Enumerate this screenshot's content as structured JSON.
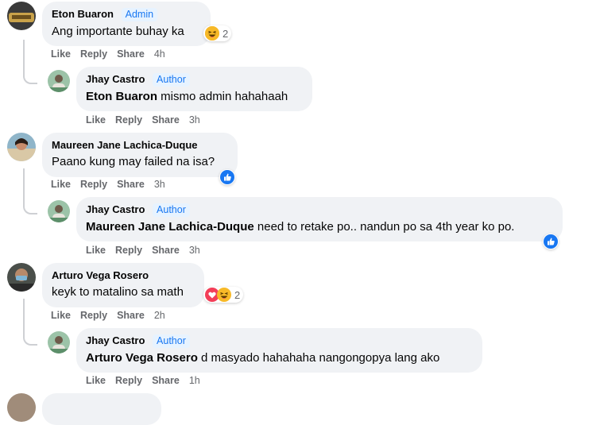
{
  "labels": {
    "like": "Like",
    "reply": "Reply",
    "share": "Share"
  },
  "comments": [
    {
      "author": "Eton Buaron",
      "badge": "Admin",
      "text": "Ang importante buhay ka",
      "reaction_count": "2",
      "time": "4h",
      "reply": {
        "author": "Jhay Castro",
        "badge": "Author",
        "tag": "Eton Buaron",
        "text": "mismo admin hahahaah",
        "time": "3h"
      }
    },
    {
      "author": "Maureen Jane Lachica-Duque",
      "text": "Paano kung may failed na isa?",
      "time": "3h",
      "reply": {
        "author": "Jhay Castro",
        "badge": "Author",
        "tag": "Maureen Jane Lachica-Duque",
        "text": "need to retake po.. nandun po sa 4th year ko po.",
        "time": "3h"
      }
    },
    {
      "author": "Arturo Vega Rosero",
      "text": "keyk to matalino sa math",
      "reaction_count": "2",
      "time": "2h",
      "reply": {
        "author": "Jhay Castro",
        "badge": "Author",
        "tag": "Arturo Vega Rosero",
        "text": "d masyado hahahaha nangongopya lang ako",
        "time": "1h"
      }
    }
  ],
  "colors": {
    "badge_text": "#1877f2",
    "badge_bg": "#e7f3ff",
    "bubble": "#f0f2f5",
    "meta": "#65676b"
  }
}
